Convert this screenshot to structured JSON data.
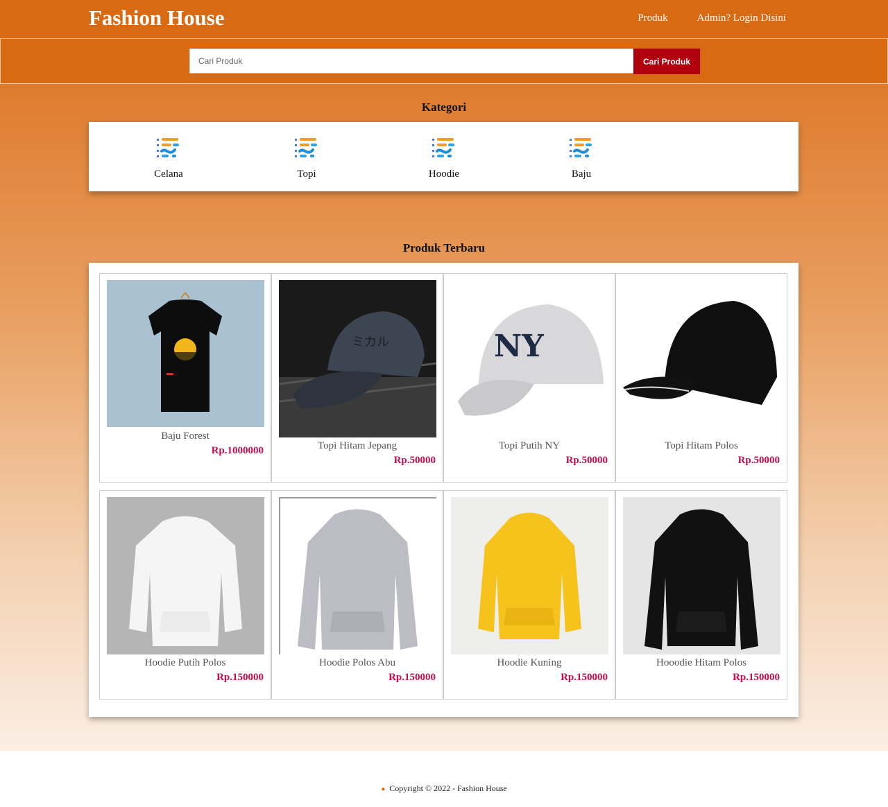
{
  "header": {
    "brand": "Fashion House",
    "nav": [
      "Produk",
      "Admin? Login Disini"
    ]
  },
  "search": {
    "placeholder": "Cari Produk",
    "button": "Cari Produk"
  },
  "categories": {
    "title": "Kategori",
    "items": [
      "Celana",
      "Topi",
      "Hoodie",
      "Baju"
    ]
  },
  "products": {
    "title": "Produk Terbaru",
    "items": [
      {
        "name": "Baju Forest",
        "price": "Rp.1000000"
      },
      {
        "name": "Topi Hitam Jepang",
        "price": "Rp.50000"
      },
      {
        "name": "Topi Putih NY",
        "price": "Rp.50000"
      },
      {
        "name": "Topi Hitam Polos",
        "price": "Rp.50000"
      },
      {
        "name": "Hoodie Putih Polos",
        "price": "Rp.150000"
      },
      {
        "name": "Hoodie Polos Abu",
        "price": "Rp.150000"
      },
      {
        "name": "Hoodie Kuning",
        "price": "Rp.150000"
      },
      {
        "name": "Hooodie Hitam Polos",
        "price": "Rp.150000"
      }
    ]
  },
  "footer": {
    "text": "Copyright © 2022 - Fashion House"
  }
}
